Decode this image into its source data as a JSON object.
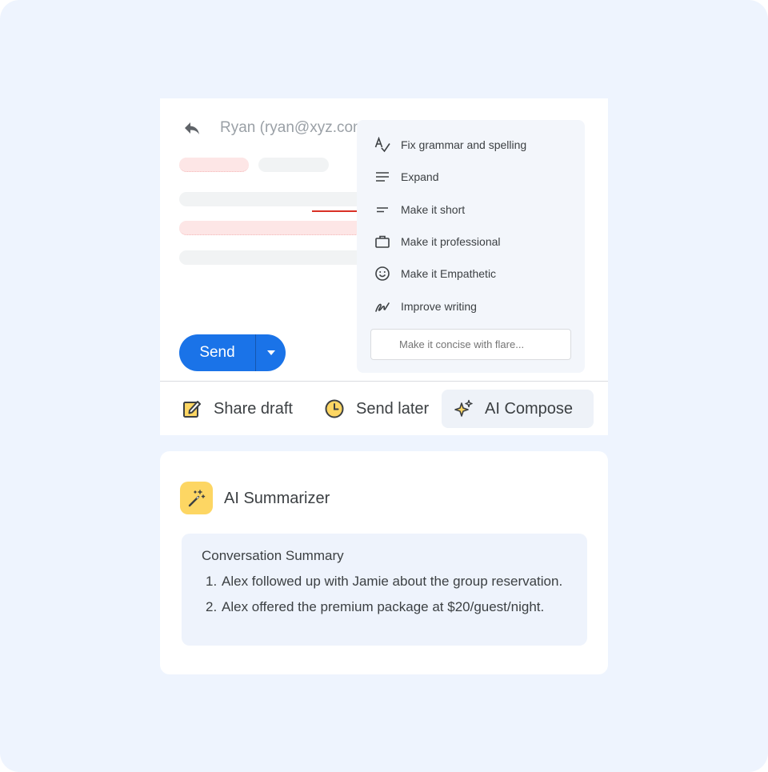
{
  "compose": {
    "recipient": "Ryan (ryan@xyz.com",
    "send_label": "Send"
  },
  "ai_menu": {
    "items": [
      {
        "label": "Fix grammar and spelling",
        "icon": "spellcheck-icon"
      },
      {
        "label": "Expand",
        "icon": "expand-lines-icon"
      },
      {
        "label": "Make it short",
        "icon": "short-lines-icon"
      },
      {
        "label": "Make it professional",
        "icon": "briefcase-icon"
      },
      {
        "label": "Make it Empathetic",
        "icon": "smiley-icon"
      },
      {
        "label": "Improve writing",
        "icon": "handwriting-icon"
      }
    ],
    "input_placeholder": "Make it concise with flare..."
  },
  "toolbar": {
    "share_draft": "Share draft",
    "send_later": "Send later",
    "ai_compose": "AI Compose"
  },
  "summarizer": {
    "title": "AI Summarizer",
    "heading": "Conversation Summary",
    "items": [
      {
        "num": "1.",
        "text": "Alex followed up with Jamie about the group reservation."
      },
      {
        "num": "2.",
        "text": "Alex offered the premium package at $20/guest/night."
      }
    ]
  },
  "colors": {
    "background": "#eef4fe",
    "accent_blue": "#1a73e8",
    "icon_yellow": "#fdd663",
    "placeholder_pink": "#fde6e6",
    "error_red": "#d93025"
  }
}
